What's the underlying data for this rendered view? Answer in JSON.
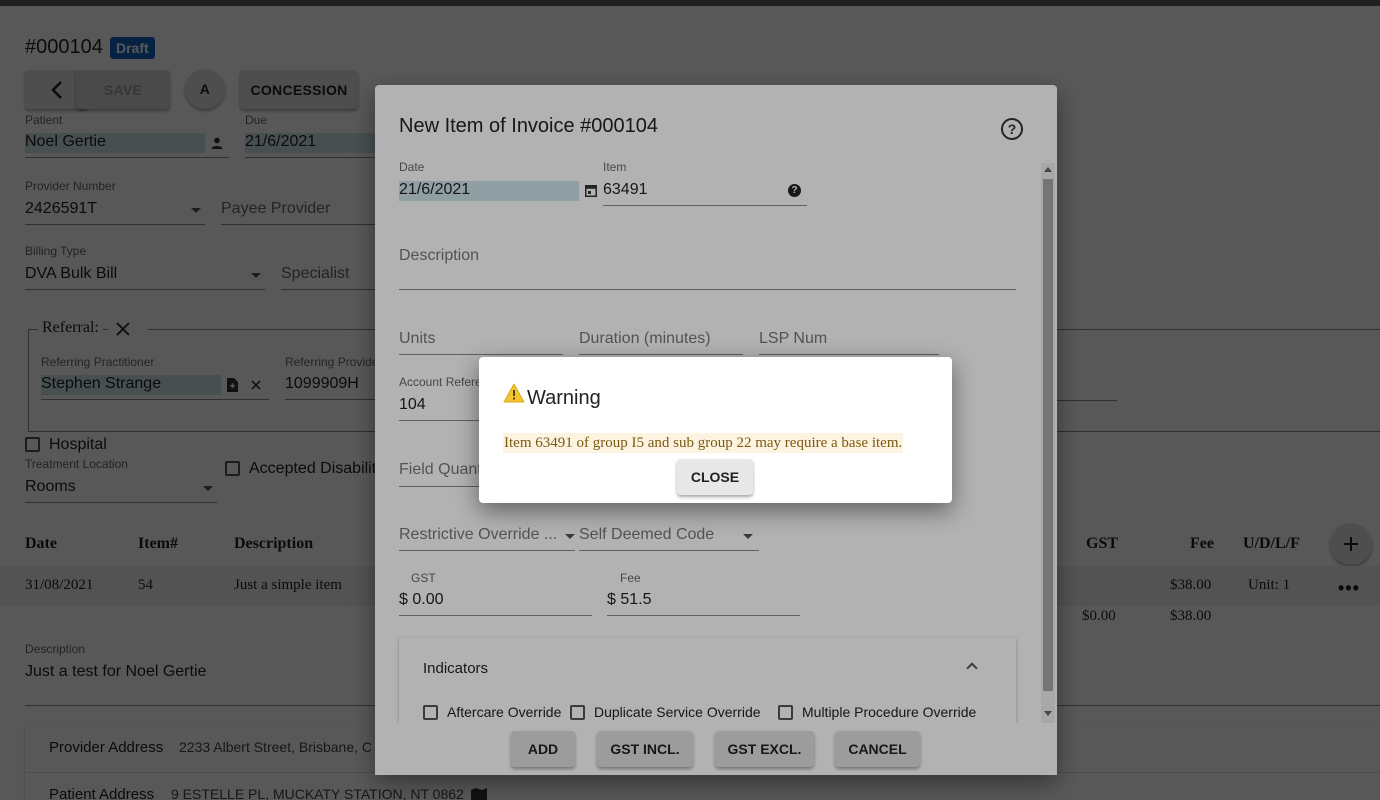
{
  "invoice": {
    "number": "#000104",
    "status_badge": "Draft",
    "toolbar": {
      "save_label": "SAVE",
      "a_label": "A",
      "concession_label": "CONCESSION"
    },
    "patient": {
      "label": "Patient",
      "value": "Noel Gertie"
    },
    "due": {
      "label": "Due",
      "value": "21/6/2021"
    },
    "provider_number": {
      "label": "Provider Number",
      "value": "2426591T"
    },
    "payee_provider": {
      "placeholder": "Payee Provider"
    },
    "billing_type": {
      "label": "Billing Type",
      "value": "DVA Bulk Bill"
    },
    "specialist": {
      "placeholder": "Specialist"
    },
    "referral": {
      "legend": "Referral:",
      "referring_practitioner": {
        "label": "Referring Practitioner",
        "value": "Stephen Strange"
      },
      "referring_provider": {
        "label": "Referring Provide",
        "value": "1099909H"
      }
    },
    "hospital_label": "Hospital",
    "treatment_location": {
      "label": "Treatment Location",
      "value": "Rooms"
    },
    "accepted_disability_label": "Accepted Disabilit",
    "table": {
      "headers": [
        "Date",
        "Item#",
        "Description",
        "GST",
        "Fee",
        "U/D/L/F"
      ],
      "rows": [
        {
          "date": "31/08/2021",
          "item": "54",
          "description": "Just a simple item",
          "fee": "$38.00",
          "udlf": "Unit: 1"
        }
      ],
      "totals": {
        "gst": "$0.00",
        "fee": "$38.00"
      }
    },
    "description": {
      "label": "Description",
      "value": "Just a test for Noel Gertie"
    },
    "provider_address": {
      "label": "Provider Address",
      "value": "2233 Albert Street, Brisbane, C"
    },
    "patient_address": {
      "label": "Patient Address",
      "value": "9 ESTELLE PL, MUCKATY STATION, NT 0862"
    }
  },
  "item_dialog": {
    "title": "New Item of Invoice #000104",
    "date": {
      "label": "Date",
      "value": "21/6/2021"
    },
    "item": {
      "label": "Item",
      "value": "63491"
    },
    "description_placeholder": "Description",
    "units_placeholder": "Units",
    "duration_placeholder": "Duration (minutes)",
    "lsp_placeholder": "LSP Num",
    "account_reference": {
      "label": "Account Refere",
      "value": "104"
    },
    "field_quantity_placeholder": "Field Quant",
    "restrictive_override_placeholder": "Restrictive Override ...",
    "self_deemed_placeholder": "Self Deemed Code",
    "gst": {
      "label": "GST",
      "value": "$ 0.00"
    },
    "fee": {
      "label": "Fee",
      "value": "$ 51.5"
    },
    "indicators": {
      "title": "Indicators",
      "checkboxes": [
        "Aftercare Override",
        "Duplicate Service Override",
        "Multiple Procedure Override"
      ]
    },
    "buttons": {
      "add": "ADD",
      "gst_incl": "GST INCL.",
      "gst_excl": "GST EXCL.",
      "cancel": "CANCEL"
    }
  },
  "warning_dialog": {
    "title": "Warning",
    "message": "Item 63491 of group I5 and sub group 22 may require a base item.",
    "close_label": "CLOSE"
  },
  "colors": {
    "draft_badge": "#1565c0",
    "field_highlight": "#cfe4ea",
    "warning_icon": "#f2c432",
    "warning_text": "#7a5a12"
  }
}
